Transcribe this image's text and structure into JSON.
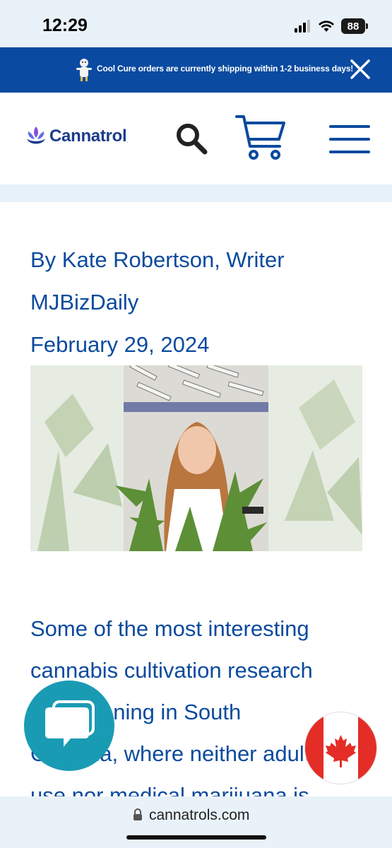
{
  "status_bar": {
    "time": "12:29",
    "battery": "88"
  },
  "announcement": {
    "text": "Cool Cure orders are currently shipping within 1-2 business days!"
  },
  "header": {
    "logo_text": "Cannatrol",
    "logo_tm": "."
  },
  "article_meta": {
    "author": "By Kate Robertson, Writer",
    "source": "MJBizDaily",
    "date": "February 29, 2024"
  },
  "article": {
    "lines": [
      "Some of the most interesting",
      "cannabis cultivation research",
      "is happening in South",
      "Carolina, where neither adult-",
      "use nor medical marijuana is"
    ]
  },
  "browser": {
    "url": "cannatrols.com"
  },
  "colors": {
    "brand_blue": "#0a4aa0",
    "text_blue": "#0b4a9e",
    "chat_teal": "#1a9bb4",
    "canada_red": "#e52d27"
  },
  "icons": [
    "mascot-icon",
    "close-icon",
    "logo-icon",
    "search-icon",
    "cart-icon",
    "menu-icon",
    "chat-icon",
    "canada-flag-icon",
    "lock-icon",
    "signal-icon",
    "wifi-icon",
    "battery-icon"
  ]
}
